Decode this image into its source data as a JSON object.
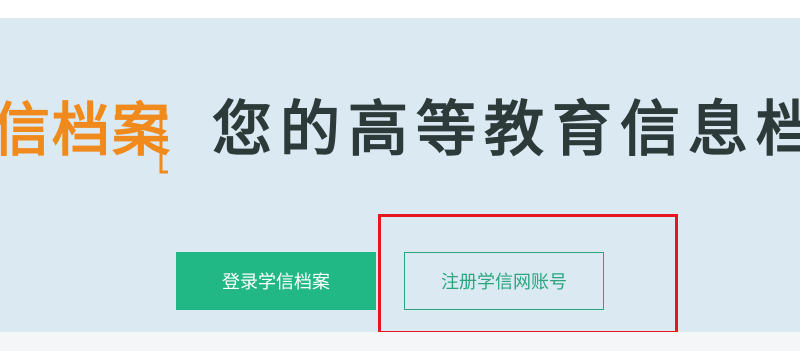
{
  "brand": {
    "text": "信档案",
    "color": "#f08a1c"
  },
  "slogan": {
    "text": "您的高等教育信息档"
  },
  "buttons": {
    "login_label": "登录学信档案",
    "register_label": "注册学信网账号"
  },
  "colors": {
    "panel_background": "#dbe9f3",
    "primary_green": "#22b886",
    "outline_green": "#2aa57d",
    "annotation_red": "#e8141f",
    "heading_dark": "#2c3a3a"
  }
}
